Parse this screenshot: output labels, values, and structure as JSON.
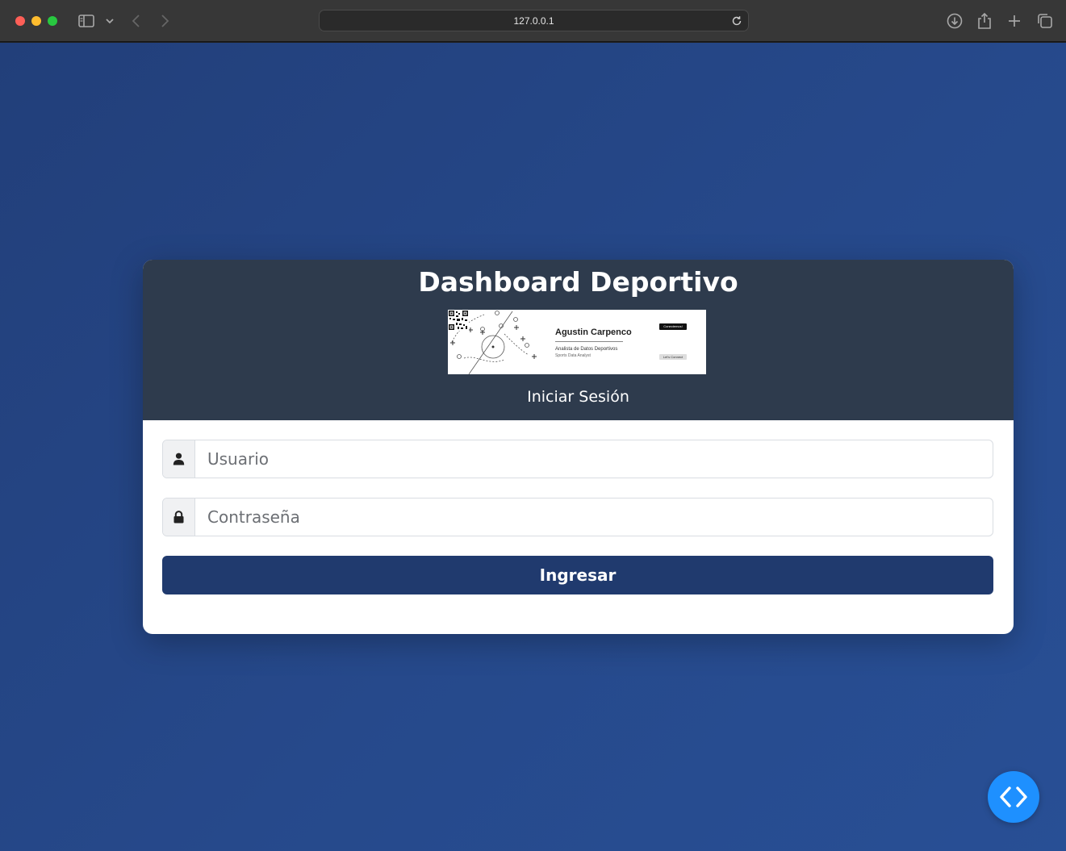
{
  "browser": {
    "url": "127.0.0.1"
  },
  "card": {
    "title": "Dashboard Deportivo",
    "subtitle": "Iniciar Sesión",
    "banner": {
      "name": "Agustin Carpenco",
      "role": "Analista de Datos Deportivos",
      "sub_role": "Sports Data Analyst",
      "qr_tag": "Conectemos!",
      "qr_cta": "Let's Connect"
    }
  },
  "form": {
    "username_placeholder": "Usuario",
    "password_placeholder": "Contraseña",
    "submit_label": "Ingresar"
  },
  "icons": {
    "username": "user-icon",
    "password": "lock-icon",
    "fab": "code-icon"
  },
  "colors": {
    "background": "#26498b",
    "header": "#2e3b4d",
    "button": "#203a6e",
    "fab": "#1e90ff"
  }
}
